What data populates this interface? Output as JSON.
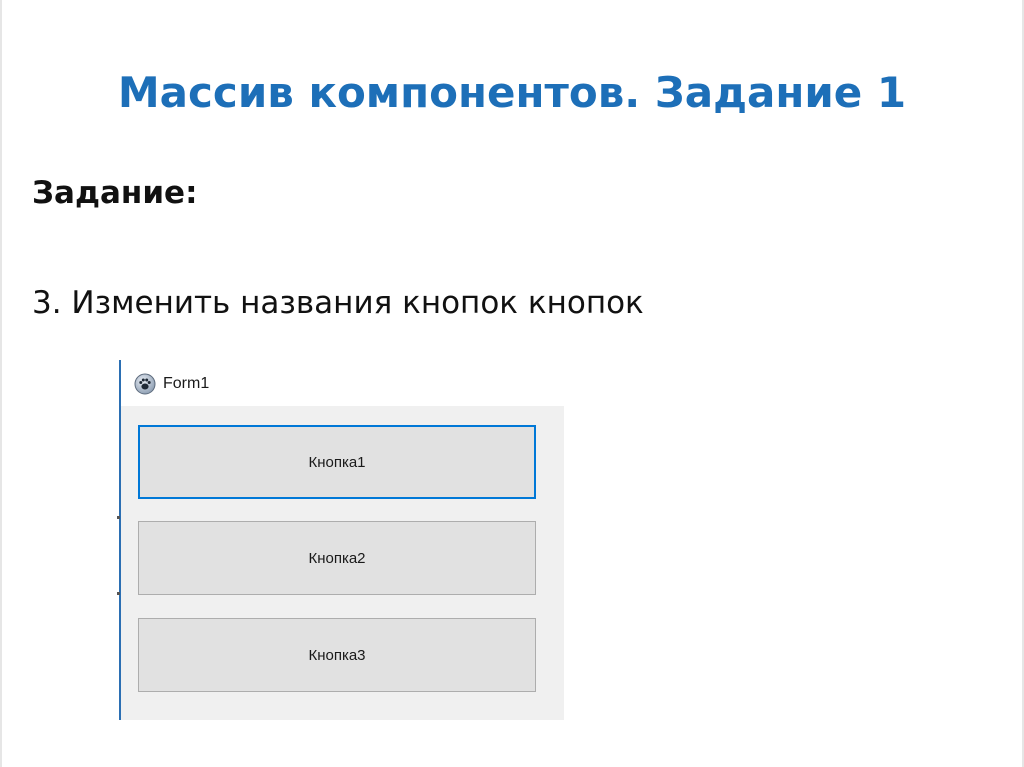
{
  "slide": {
    "title": "Массив компонентов. Задание 1",
    "task_heading": "Задание:",
    "task_item": "3. Изменить названия кнопок кнопок"
  },
  "window": {
    "title": "Form1",
    "icon": "app-paw-icon",
    "buttons": [
      {
        "label": "Кнопка1",
        "focused": true
      },
      {
        "label": "Кнопка2",
        "focused": false
      },
      {
        "label": "Кнопка3",
        "focused": false
      }
    ]
  },
  "colors": {
    "title": "#1d6fb8",
    "focus_border": "#0078d7",
    "button_face": "#e1e1e1",
    "client_bg": "#f0f0f0"
  }
}
